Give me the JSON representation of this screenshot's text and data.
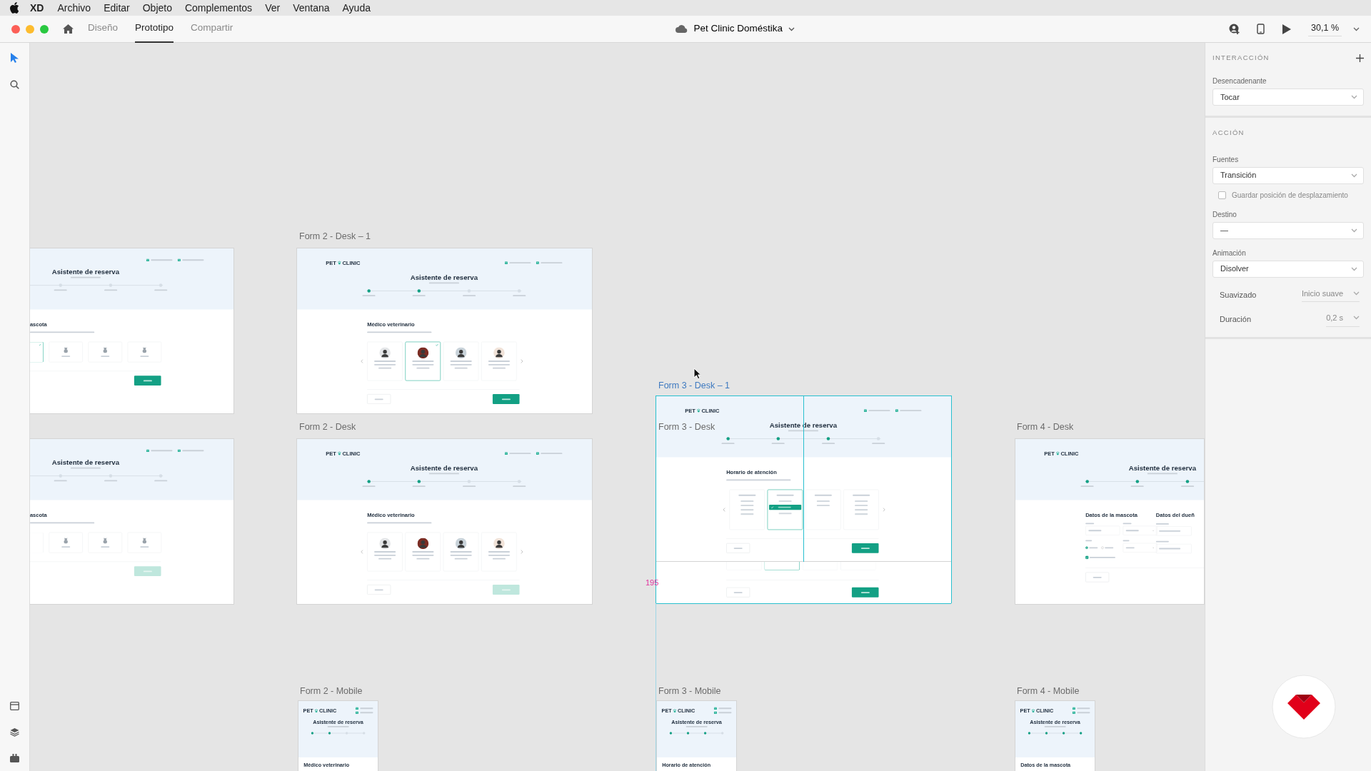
{
  "menu_bar": {
    "app": "XD",
    "items": [
      "Archivo",
      "Editar",
      "Objeto",
      "Complementos",
      "Ver",
      "Ventana",
      "Ayuda"
    ]
  },
  "title_bar": {
    "tabs": [
      {
        "label": "Diseño",
        "selected": false
      },
      {
        "label": "Prototipo",
        "selected": true
      },
      {
        "label": "Compartir",
        "selected": false
      }
    ],
    "document": "Pet Clinic Doméstika",
    "zoom": "30,1 %"
  },
  "canvas": {
    "artboards": [
      {
        "kind": "pets",
        "selected": false,
        "contact": true,
        "title": "Asistente de reserva",
        "steps": [
          {
            "done": false
          },
          {
            "done": false
          },
          {
            "done": false
          }
        ],
        "heading": "ascota",
        "pets": [
          {
            "selected": true
          },
          {
            "selected": false
          },
          {
            "selected": false
          },
          {
            "selected": false
          }
        ],
        "buttons": [
          {
            "kind": "next",
            "enabled": true
          }
        ]
      },
      {
        "kind": "doctors",
        "label": "Form 2 - Desk – 1",
        "selected": false,
        "logo": [
          "PET",
          "CLINIC"
        ],
        "contact": true,
        "title": "Asistente de reserva",
        "steps": [
          {
            "done": true
          },
          {
            "done": true
          },
          {
            "done": false
          },
          {
            "done": false
          }
        ],
        "heading": "Médico veterinario",
        "doctors": [
          {
            "selected": false
          },
          {
            "selected": true
          },
          {
            "selected": false
          },
          {
            "selected": false
          }
        ],
        "buttons": [
          {
            "kind": "back"
          },
          {
            "kind": "next",
            "enabled": true
          }
        ]
      },
      {
        "kind": "days",
        "label": "Form 3 - Desk – 1",
        "selected": true,
        "logo": [
          "PET",
          "CLINIC"
        ],
        "contact": true,
        "title": "Asistente de reserva",
        "steps": [
          {
            "done": true
          },
          {
            "done": true
          },
          {
            "done": true
          },
          {
            "done": false
          }
        ],
        "heading": "Horario de atención",
        "days": [
          {
            "selected": false,
            "slots": [
              {
                "selected": false
              },
              {
                "selected": false
              },
              {
                "selected": false
              },
              {
                "selected": false
              }
            ]
          },
          {
            "selected": true,
            "slots": [
              {
                "selected": false
              },
              {
                "selected": true
              },
              {
                "selected": false
              }
            ]
          },
          {
            "selected": false,
            "slots": [
              {
                "selected": false
              },
              {
                "selected": false
              }
            ]
          },
          {
            "selected": false,
            "slots": [
              {
                "selected": false
              },
              {
                "selected": false
              },
              {
                "selected": false
              },
              {
                "selected": false
              }
            ]
          }
        ],
        "buttons": [
          {
            "kind": "back"
          },
          {
            "kind": "next",
            "enabled": true
          }
        ]
      },
      {
        "kind": "pets",
        "selected": false,
        "contact": true,
        "title": "Asistente de reserva",
        "steps": [
          {
            "done": false
          },
          {
            "done": false
          },
          {
            "done": false
          }
        ],
        "heading": "ascota",
        "pets": [
          {
            "selected": false
          },
          {
            "selected": false
          },
          {
            "selected": false
          },
          {
            "selected": false
          }
        ],
        "buttons": [
          {
            "kind": "next",
            "enabled": false
          }
        ]
      },
      {
        "kind": "doctors",
        "label": "Form 2 - Desk",
        "selected": false,
        "logo": [
          "PET",
          "CLINIC"
        ],
        "contact": true,
        "title": "Asistente de reserva",
        "steps": [
          {
            "done": true
          },
          {
            "done": true
          },
          {
            "done": false
          },
          {
            "done": false
          }
        ],
        "heading": "Médico veterinario",
        "doctors": [
          {
            "selected": false
          },
          {
            "selected": false
          },
          {
            "selected": false
          },
          {
            "selected": false
          }
        ],
        "buttons": [
          {
            "kind": "back"
          },
          {
            "kind": "next",
            "enabled": false
          }
        ]
      },
      {
        "kind": "stub",
        "label": "Form 3 - Desk",
        "selected": false,
        "cards": [
          {
            "selected": false
          },
          {
            "selected": true
          },
          {
            "selected": false
          },
          {
            "selected": false
          }
        ],
        "buttons": [
          {
            "kind": "back"
          },
          {
            "kind": "next",
            "enabled": true
          }
        ]
      },
      {
        "kind": "form",
        "label": "Form 4 - Desk",
        "selected": false,
        "logo": [
          "PET",
          "CLINIC"
        ],
        "title": "Asistente de reserva",
        "steps": [
          {
            "done": true
          },
          {
            "done": true
          },
          {
            "done": true
          }
        ],
        "heading": "Datos de la mascota",
        "heading_2": "Datos del dueñ",
        "sex_options": [
          {
            "selected": true
          },
          {
            "selected": false
          }
        ],
        "vaccines": {
          "checked": true
        },
        "buttons": [
          {
            "kind": "back"
          }
        ]
      },
      {
        "kind": "mobile",
        "label": "Form 2 - Mobile",
        "selected": false,
        "logo": [
          "PET",
          "CLINIC"
        ],
        "contact": true,
        "title": "Asistente de reserva",
        "steps": [
          {
            "done": true
          },
          {
            "done": true
          },
          {
            "done": false
          },
          {
            "done": false
          }
        ],
        "heading": "Médico veterinario"
      },
      {
        "kind": "mobile",
        "label": "Form 3 - Mobile",
        "selected": false,
        "logo": [
          "PET",
          "CLINIC"
        ],
        "contact": true,
        "title": "Asistente de reserva",
        "steps": [
          {
            "done": true
          },
          {
            "done": true
          },
          {
            "done": true
          },
          {
            "done": false
          }
        ],
        "heading": "Horario de atención"
      },
      {
        "kind": "mobile",
        "label": "Form 4 - Mobile",
        "selected": false,
        "logo": [
          "PET",
          "CLINIC"
        ],
        "contact": true,
        "title": "Asistente de reserva",
        "steps": [
          {
            "done": true
          },
          {
            "done": true
          },
          {
            "done": true
          },
          {
            "done": true
          }
        ],
        "heading": "Datos de la mascota"
      }
    ],
    "distance_label": "195"
  },
  "panel": {
    "interaction": {
      "title": "INTERACCIÓN",
      "trigger_label": "Desencadenante",
      "trigger": "Tocar"
    },
    "action": {
      "title": "ACCIÓN",
      "type_label": "Fuentes",
      "type": "Transición",
      "preserve_scroll": {
        "label": "Guardar posición de desplazamiento",
        "checked": false
      },
      "destination_label": "Destino",
      "destination": "—",
      "animation_label": "Animación",
      "animation": "Disolver",
      "easing_label": "Suavizado",
      "easing": "Inicio suave",
      "duration_label": "Duración",
      "duration": "0,2 s"
    }
  }
}
